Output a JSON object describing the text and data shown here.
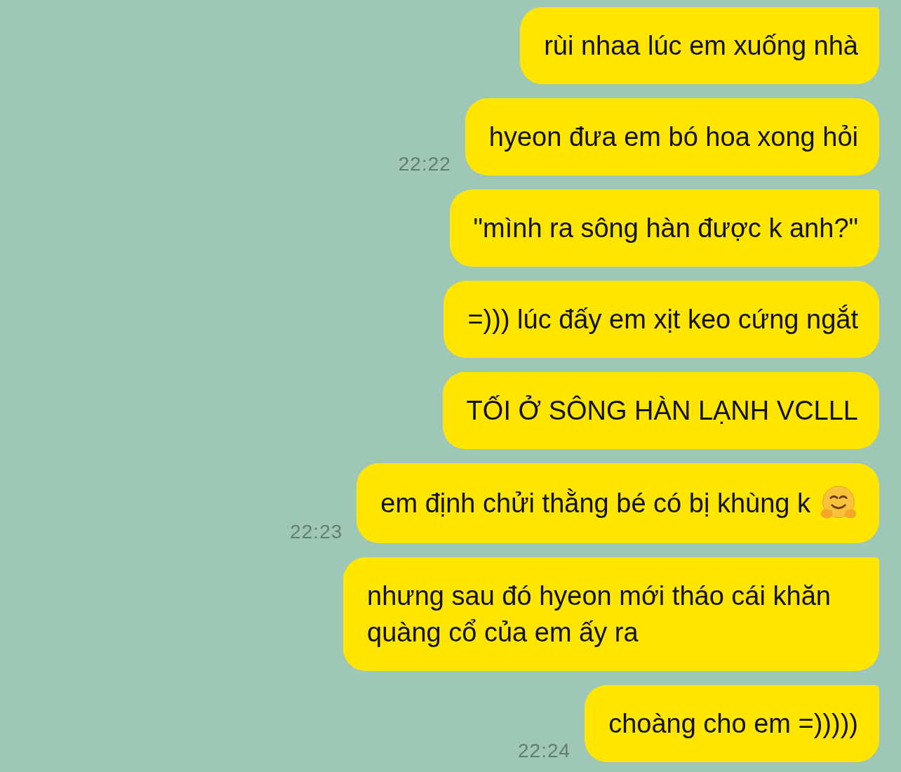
{
  "messages": [
    {
      "text": "rùi nhaa lúc em xuống nhà",
      "tail": true
    },
    {
      "text": "hyeon đưa em bó hoa xong hỏi",
      "tail": false,
      "time": "22:22"
    },
    {
      "text": "\"mình ra sông hàn được k anh?\"",
      "tail": true
    },
    {
      "text": "=))) lúc đấy em xịt keo cứng ngắt",
      "tail": false
    },
    {
      "text": "TỐI Ở SÔNG HÀN LẠNH VCLLL",
      "tail": false
    },
    {
      "text": "em định chửi thằng bé có bị khùng k",
      "tail": false,
      "time": "22:23",
      "emoji": true
    },
    {
      "text": "nhưng sau đó hyeon mới tháo cái khăn quàng cổ của em ấy ra",
      "tail": true
    },
    {
      "text": "choàng cho em =)))))",
      "tail": true,
      "time": "22:24"
    }
  ]
}
